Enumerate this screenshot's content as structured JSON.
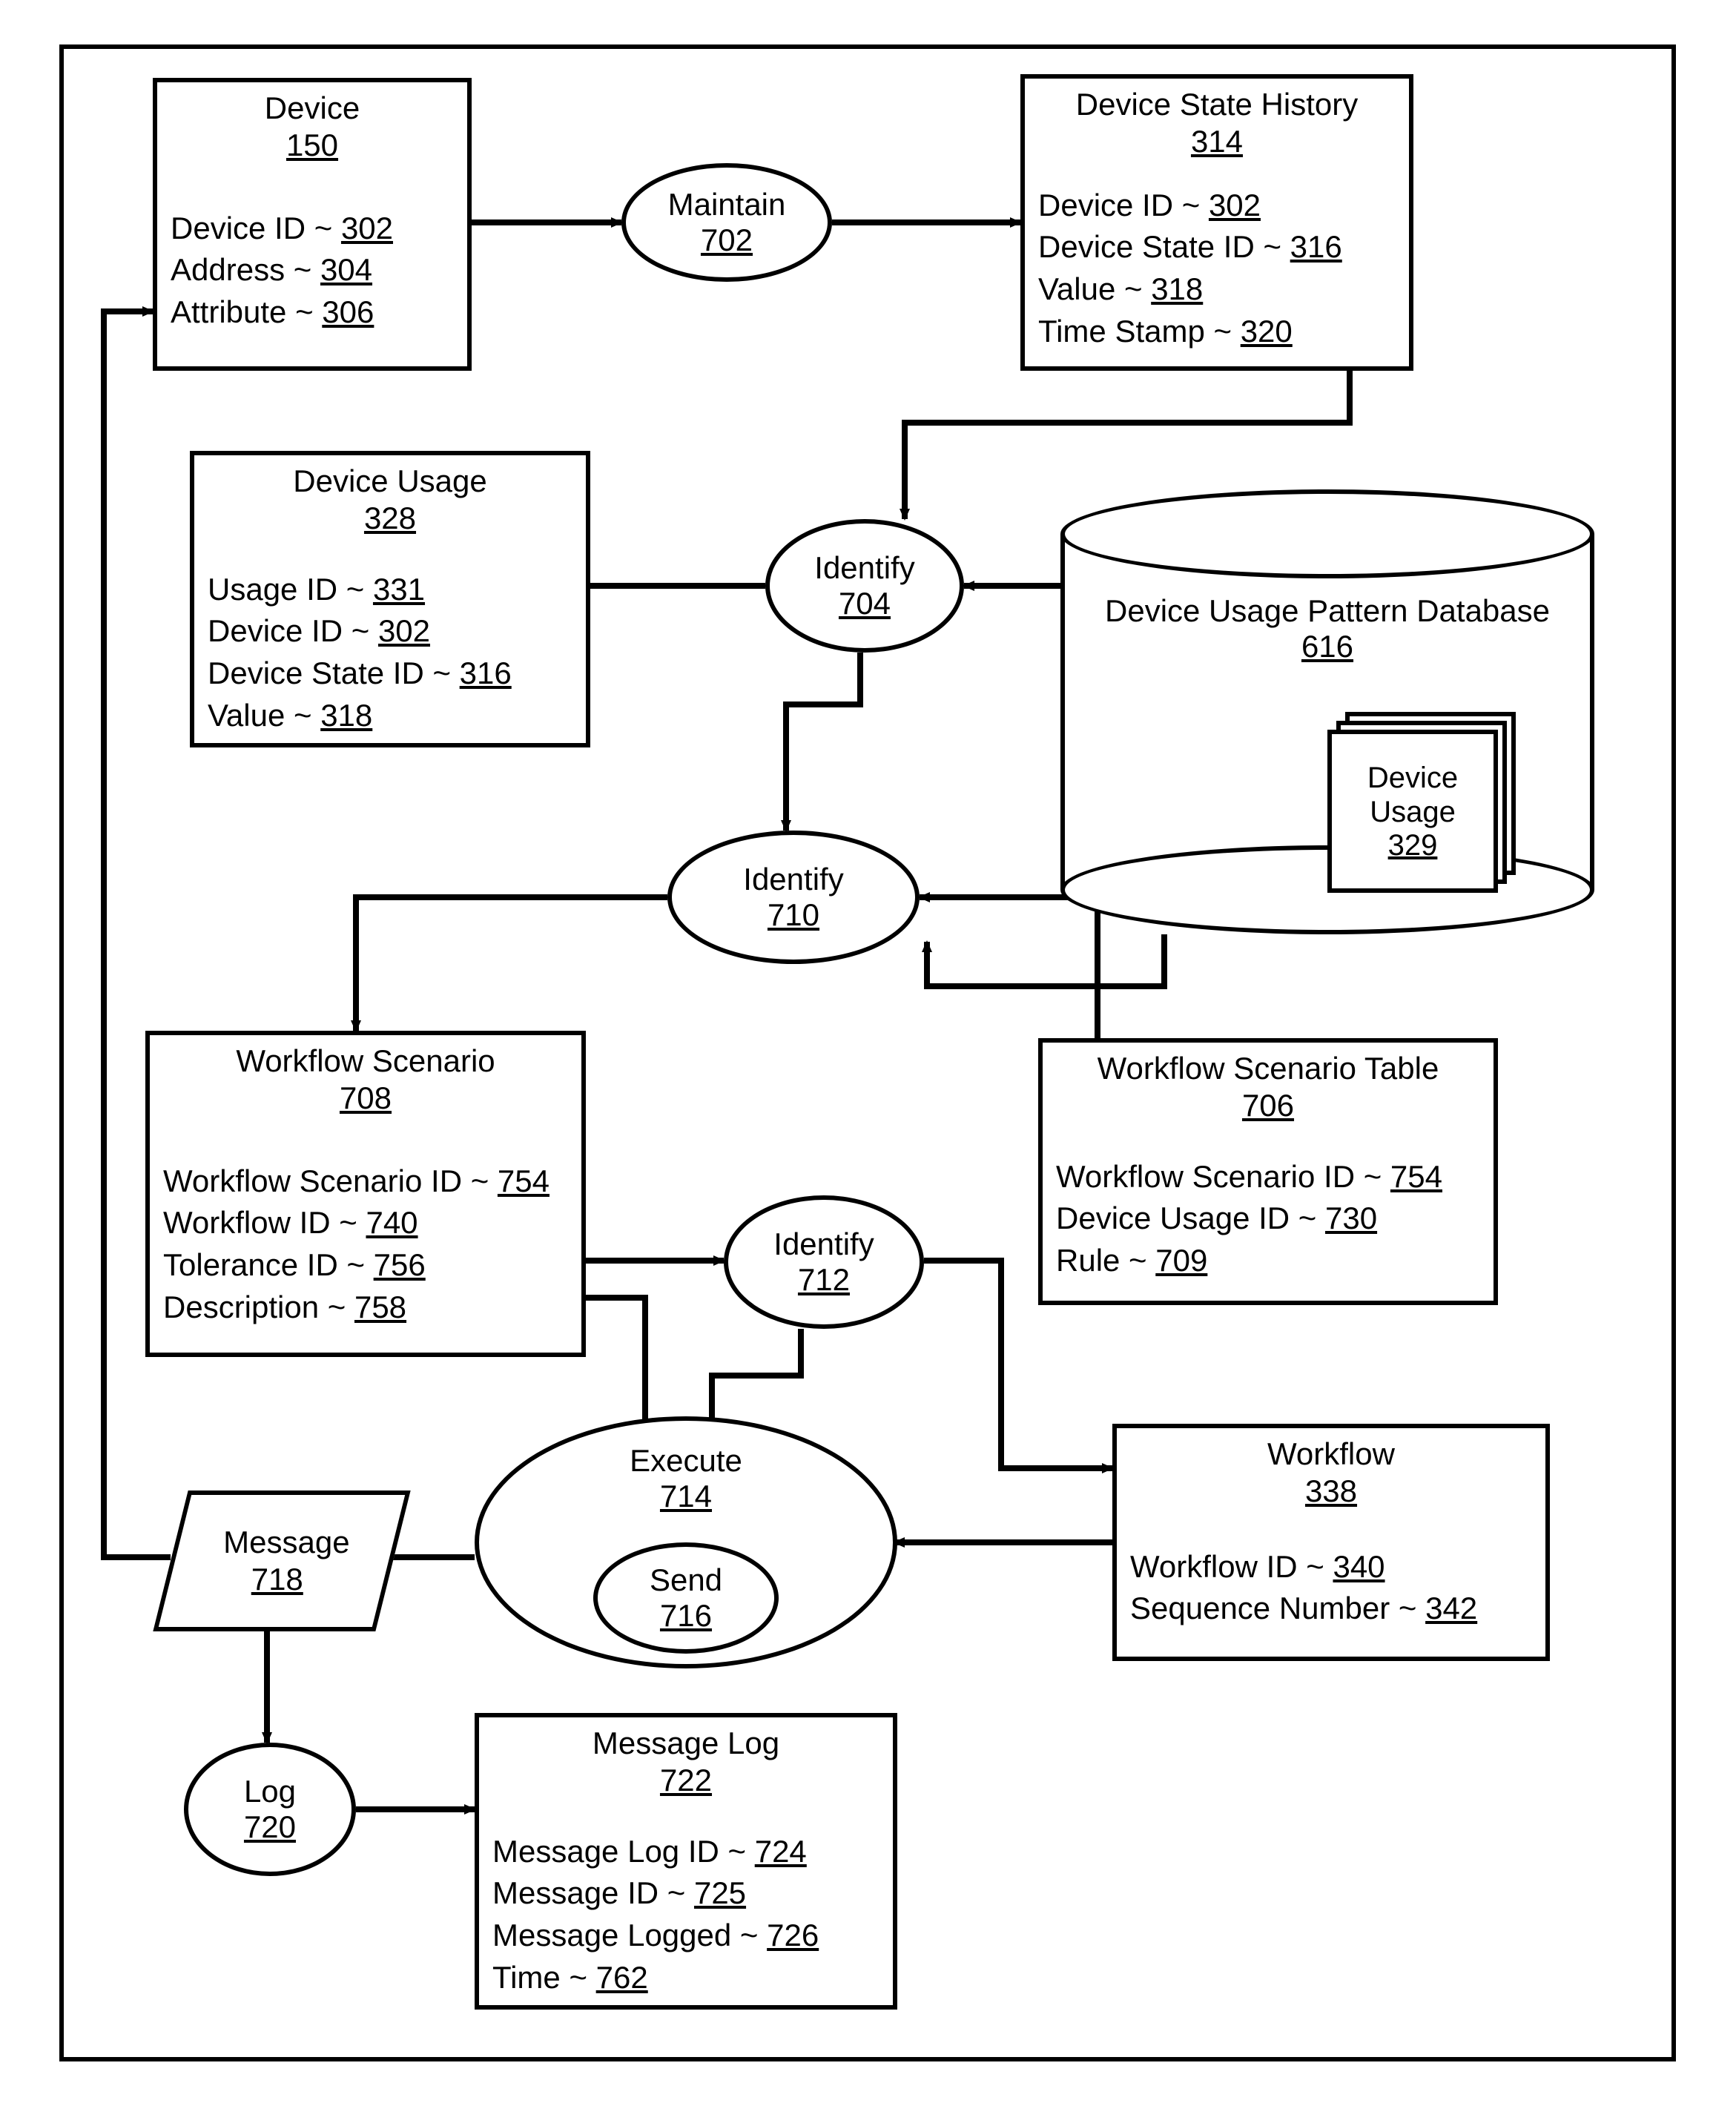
{
  "nodes": {
    "device": {
      "title": "Device",
      "ref": "150",
      "fields": [
        {
          "label": "Device ID",
          "num": "302"
        },
        {
          "label": "Address",
          "num": "304"
        },
        {
          "label": "Attribute",
          "num": "306"
        }
      ]
    },
    "deviceStateHistory": {
      "title": "Device State History",
      "ref": "314",
      "fields": [
        {
          "label": "Device ID",
          "num": "302"
        },
        {
          "label": "Device State ID",
          "num": "316"
        },
        {
          "label": "Value",
          "num": "318"
        },
        {
          "label": "Time Stamp",
          "num": "320"
        }
      ]
    },
    "deviceUsage": {
      "title": "Device Usage",
      "ref": "328",
      "fields": [
        {
          "label": "Usage ID",
          "num": "331"
        },
        {
          "label": "Device ID",
          "num": "302"
        },
        {
          "label": "Device State ID",
          "num": "316"
        },
        {
          "label": "Value",
          "num": "318"
        }
      ]
    },
    "workflowScenario": {
      "title": "Workflow Scenario",
      "ref": "708",
      "fields": [
        {
          "label": "Workflow Scenario ID",
          "num": "754"
        },
        {
          "label": "Workflow ID",
          "num": "740"
        },
        {
          "label": "Tolerance ID",
          "num": "756"
        },
        {
          "label": "Description",
          "num": "758"
        }
      ]
    },
    "workflowScenarioTable": {
      "title": "Workflow Scenario Table",
      "ref": "706",
      "fields": [
        {
          "label": "Workflow Scenario ID",
          "num": "754"
        },
        {
          "label": "Device Usage ID",
          "num": "730"
        },
        {
          "label": "Rule",
          "num": "709"
        }
      ]
    },
    "workflow": {
      "title": "Workflow",
      "ref": "338",
      "fields": [
        {
          "label": "Workflow ID",
          "num": "340"
        },
        {
          "label": "Sequence Number",
          "num": "342"
        }
      ]
    },
    "messageLog": {
      "title": "Message Log",
      "ref": "722",
      "fields": [
        {
          "label": "Message Log ID",
          "num": "724"
        },
        {
          "label": "Message ID",
          "num": "725"
        },
        {
          "label": "Message Logged",
          "num": "726"
        },
        {
          "label": "Time",
          "num": "762"
        }
      ]
    },
    "maintain": {
      "label": "Maintain",
      "ref": "702"
    },
    "identify1": {
      "label": "Identify",
      "ref": "704"
    },
    "identify2": {
      "label": "Identify",
      "ref": "710"
    },
    "identify3": {
      "label": "Identify",
      "ref": "712"
    },
    "execute": {
      "label": "Execute",
      "ref": "714"
    },
    "send": {
      "label": "Send",
      "ref": "716"
    },
    "log": {
      "label": "Log",
      "ref": "720"
    },
    "message": {
      "label": "Message",
      "ref": "718"
    },
    "database": {
      "title": "Device Usage Pattern Database",
      "ref": "616"
    },
    "deviceUsageDoc": {
      "title1": "Device",
      "title2": "Usage",
      "ref": "329"
    }
  }
}
